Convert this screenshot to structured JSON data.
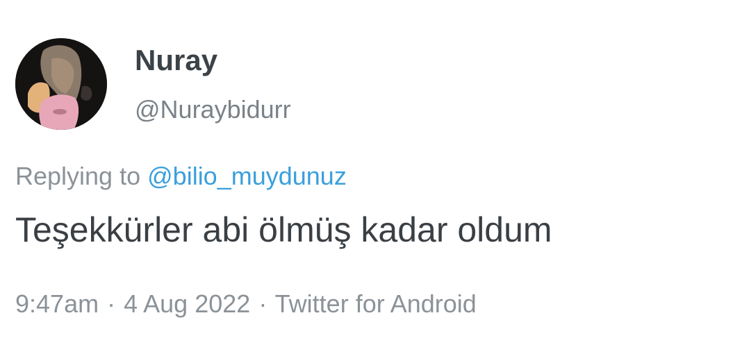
{
  "tweet": {
    "display_name": "Nuray",
    "handle": "@Nuraybidurr",
    "reply_prefix": "Replying to",
    "reply_to": "@bilio_muydunuz",
    "text": "Teşekkürler abi ölmüş kadar oldum",
    "time": "9:47am",
    "date": "4 Aug 2022",
    "source": "Twitter for Android",
    "separator": "·"
  },
  "colors": {
    "name": "#3b4248",
    "secondary": "#8b9298",
    "mention": "#3a9fdc",
    "text": "#3a3f44"
  }
}
